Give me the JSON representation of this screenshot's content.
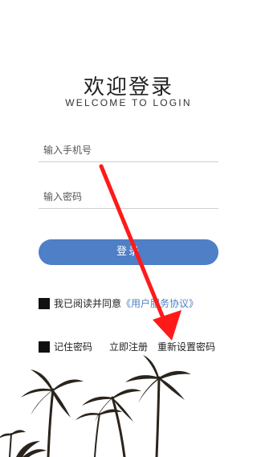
{
  "header": {
    "title": "欢迎登录",
    "subtitle": "WELCOME TO LOGIN"
  },
  "form": {
    "phone_placeholder": "输入手机号",
    "password_placeholder": "输入密码",
    "login_label": "登录"
  },
  "agreement": {
    "prefix": "我已阅读并同意",
    "link": "《用户服务协议》"
  },
  "footer": {
    "remember_label": "记住密码",
    "register_label": "立即注册",
    "reset_label": "重新设置密码"
  },
  "colors": {
    "accent": "#4f7fc6",
    "annotation_arrow": "#ff1a1a"
  }
}
